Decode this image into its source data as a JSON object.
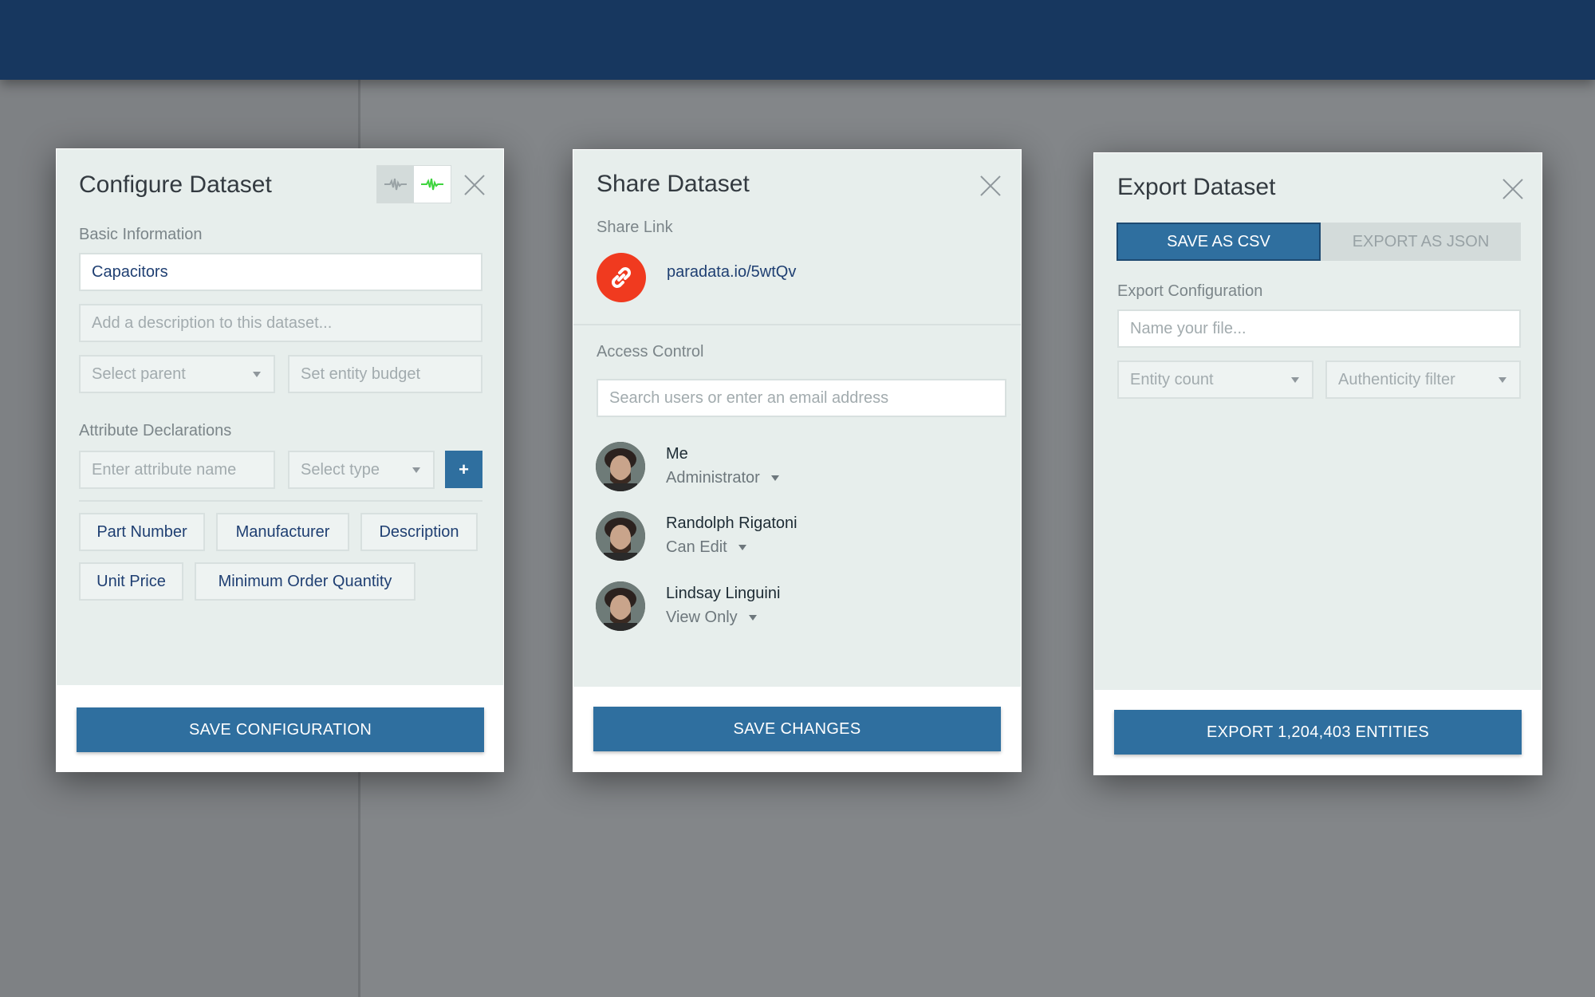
{
  "configure": {
    "title": "Configure Dataset",
    "basic_label": "Basic Information",
    "name_value": "Capacitors",
    "description_placeholder": "Add a description to this dataset...",
    "parent_placeholder": "Select parent",
    "budget_placeholder": "Set entity budget",
    "attributes_label": "Attribute Declarations",
    "attr_name_placeholder": "Enter attribute name",
    "type_placeholder": "Select type",
    "add_label": "+",
    "tags": [
      "Part Number",
      "Manufacturer",
      "Description",
      "Unit Price",
      "Minimum Order Quantity"
    ],
    "save_label": "SAVE CONFIGURATION",
    "accent_green": "#3fd43f"
  },
  "share": {
    "title": "Share Dataset",
    "link_label": "Share Link",
    "link_url": "paradata.io/5wtQv",
    "access_label": "Access Control",
    "search_placeholder": "Search users or enter an email address",
    "users": [
      {
        "name": "Me",
        "role": "Administrator"
      },
      {
        "name": "Randolph Rigatoni",
        "role": "Can Edit"
      },
      {
        "name": "Lindsay Linguini",
        "role": "View Only"
      }
    ],
    "save_label": "SAVE CHANGES",
    "link_icon_color": "#f03a1f"
  },
  "export": {
    "title": "Export Dataset",
    "tab_csv": "SAVE AS CSV",
    "tab_json": "EXPORT AS JSON",
    "config_label": "Export Configuration",
    "filename_placeholder": "Name your file...",
    "entity_count_placeholder": "Entity count",
    "authenticity_placeholder": "Authenticity filter",
    "export_label": "EXPORT 1,204,403 ENTITIES"
  },
  "colors": {
    "header": "#17375f",
    "primary": "#2f6f9f"
  }
}
